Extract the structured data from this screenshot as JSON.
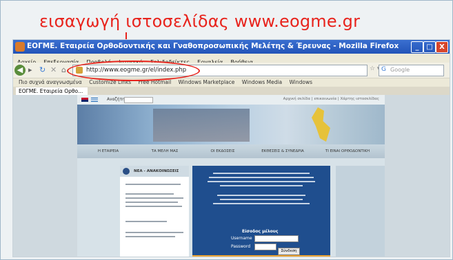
{
  "annotation": {
    "caption": "εισαγωγή ιστοσελίδας www.eogme.gr",
    "color": "#e8231c"
  },
  "window": {
    "title": "ΕΟΓΜΕ. Εταιρεία Ορθοδοντικής και Γναθοπροσωπικής Μελέτης & Έρευνας - Mozilla Firefox",
    "controls": [
      "_",
      "□",
      "X"
    ]
  },
  "menu": {
    "items": [
      "Αρχείο",
      "Επεξεργασία",
      "Προβολή",
      "Ιστορικό",
      "Σελιδοδείκτες",
      "Εργαλεία",
      "Βοήθεια"
    ]
  },
  "navigation": {
    "url": "http://www.eogme.gr/el/index.php",
    "search_placeholder": "Google"
  },
  "bookmarks": {
    "items": [
      "Πιο συχνά αναγνωσμένα",
      "Customize Links",
      "Free Hotmail",
      "Windows Marketplace",
      "Windows Media",
      "Windows"
    ]
  },
  "tab": {
    "label": "ΕΟΓΜΕ. Εταιρεία Ορθο..."
  },
  "site": {
    "search_label": "Αναζήτηση",
    "top_right": "Αρχική σελίδα | επικοινωνία | Χάρτης ιστοσελίδας",
    "nav": [
      "Η ΕΤΑΙΡΕΙΑ",
      "ΤΑ ΜΕΛΗ ΜΑΣ",
      "ΟΙ ΕΚΔΟΣΕΙΣ",
      "ΕΚΘΕΣΕΙΣ & ΣΥΝΕΔΡΙΑ",
      "ΤΙ ΕΙΝΑΙ ΟΡΘΟΔΟΝΤΙΚΗ"
    ],
    "news_title": "ΝΕΑ - ΑΝΑΚΟΙΝΩΣΕΙΣ",
    "login_title": "Είσοδος μέλους",
    "username_label": "Username",
    "password_label": "Password",
    "login_button": "Σύνδεση"
  }
}
